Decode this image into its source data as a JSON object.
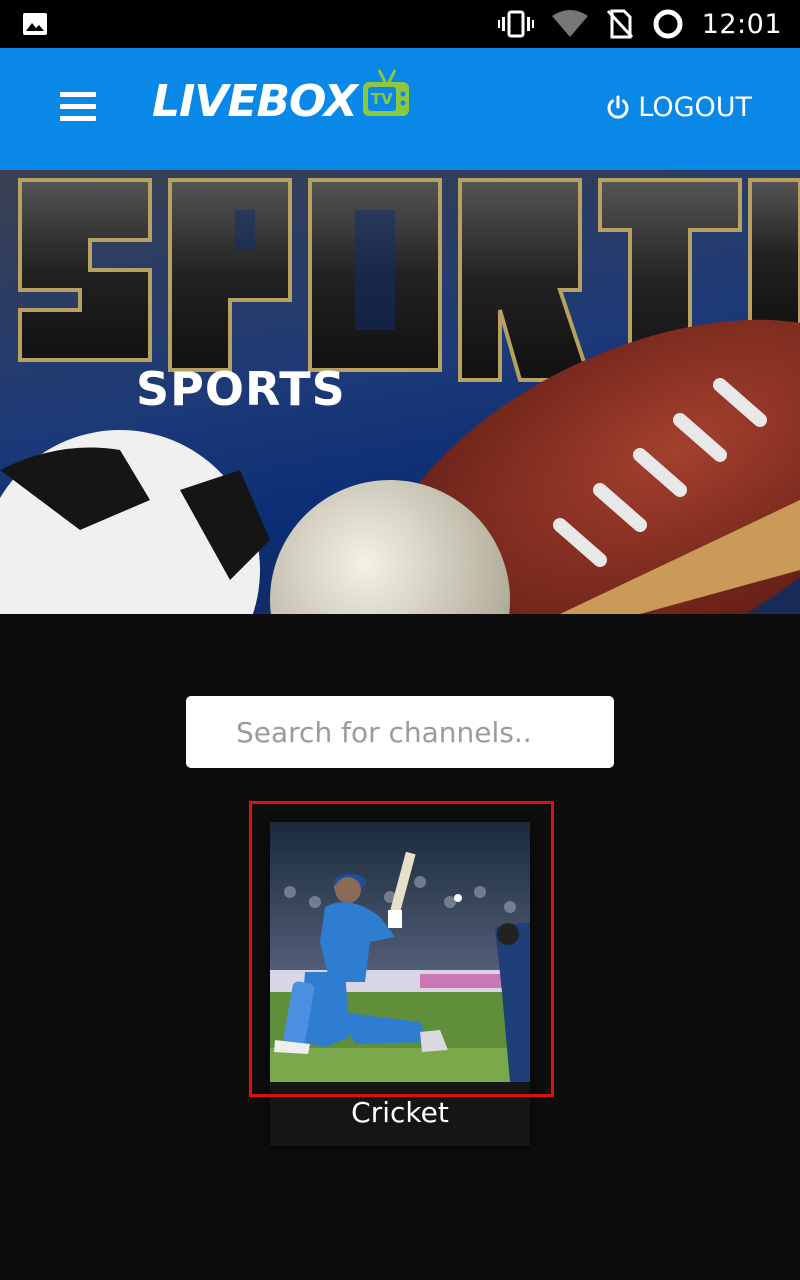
{
  "status_bar": {
    "time": "12:01",
    "icons": [
      "gallery-icon",
      "vibrate-icon",
      "wifi-icon",
      "no-sim-icon",
      "battery-icon"
    ]
  },
  "app_bar": {
    "menu_icon": "hamburger-menu-icon",
    "logo_text": "LIVEBOX",
    "logo_badge": "TV",
    "logout_label": "LOGOUT",
    "logout_icon": "power-icon",
    "background_color": "#0a88e8",
    "logo_badge_color": "#8dc63f"
  },
  "hero": {
    "title": "SPORTS"
  },
  "search": {
    "placeholder": "Search for channels.."
  },
  "channels": [
    {
      "label": "Cricket",
      "thumbnail": "cricket-batsman-image"
    }
  ],
  "colors": {
    "page_background": "#0d0d0d",
    "highlight_border": "#e01010"
  }
}
